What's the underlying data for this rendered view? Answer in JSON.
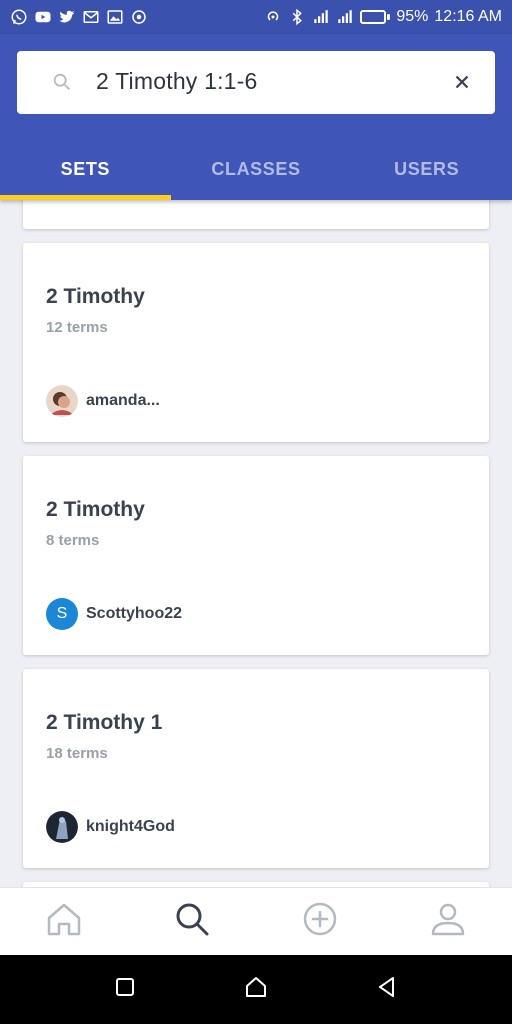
{
  "status_bar": {
    "battery_percent": "95%",
    "battery_level": 0.95,
    "time": "12:16 AM",
    "left_icons": [
      "whatsapp-icon",
      "youtube-icon",
      "twitter-icon",
      "gmail-icon",
      "gallery-icon",
      "camera-icon"
    ],
    "right_icons": [
      "hotspot-icon",
      "bluetooth-icon",
      "signal-icon",
      "signal-icon",
      "battery-icon"
    ]
  },
  "search": {
    "query": "2 Timothy 1:1-6"
  },
  "tabs": [
    {
      "label": "SETS",
      "active": true
    },
    {
      "label": "CLASSES",
      "active": false
    },
    {
      "label": "USERS",
      "active": false
    }
  ],
  "results": [
    {
      "title": "2 Timothy",
      "terms": "12 terms",
      "username": "amanda...",
      "avatar": "photo"
    },
    {
      "title": "2 Timothy",
      "terms": "8 terms",
      "username": "Scottyhoo22",
      "avatar_letter": "S",
      "avatar_color": "#1B87D6"
    },
    {
      "title": "2 Timothy 1",
      "terms": "18 terms",
      "username": "knight4God",
      "avatar": "photo"
    }
  ],
  "bottom_nav": [
    {
      "icon": "home-icon",
      "active": false
    },
    {
      "icon": "search-icon",
      "active": true
    },
    {
      "icon": "add-icon",
      "active": false
    },
    {
      "icon": "profile-icon",
      "active": false
    }
  ],
  "colors": {
    "header": "#3F56B8",
    "status_bar": "#3A51AE",
    "tab_indicator": "#FFCD1F",
    "background": "#EDEFF4"
  }
}
